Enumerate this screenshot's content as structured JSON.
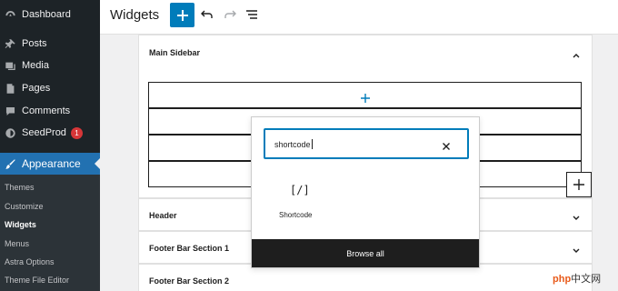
{
  "sidebar": {
    "items": [
      {
        "label": "Dashboard",
        "icon": "dashboard-icon"
      },
      {
        "label": "Posts",
        "icon": "pin-icon"
      },
      {
        "label": "Media",
        "icon": "media-icon"
      },
      {
        "label": "Pages",
        "icon": "pages-icon"
      },
      {
        "label": "Comments",
        "icon": "comment-icon"
      },
      {
        "label": "SeedProd",
        "icon": "seedprod-icon",
        "badge": "1"
      },
      {
        "label": "Appearance",
        "icon": "brush-icon",
        "active": true
      }
    ],
    "submenu": [
      "Themes",
      "Customize",
      "Widgets",
      "Menus",
      "Astra Options",
      "Theme File Editor"
    ],
    "current_submenu": "Widgets"
  },
  "header": {
    "title": "Widgets",
    "add_button": "add-block-icon",
    "undo": "undo-icon",
    "redo": "redo-icon",
    "list_view": "list-view-icon"
  },
  "panels": [
    {
      "title": "Main Sidebar",
      "expanded": true
    },
    {
      "title": "Header",
      "expanded": false
    },
    {
      "title": "Footer Bar Section 1",
      "expanded": false
    },
    {
      "title": "Footer Bar Section 2",
      "expanded": false
    }
  ],
  "inserter": {
    "search_value": "shortcode",
    "result_icon": "[/]",
    "result_label": "Shortcode",
    "browse_all": "Browse all"
  },
  "watermark": {
    "part1": "php",
    "part2": "中文网"
  },
  "colors": {
    "sidebar_bg": "#1d2327",
    "accent": "#2271b1",
    "button_blue": "#007cba",
    "badge_red": "#d63638"
  }
}
